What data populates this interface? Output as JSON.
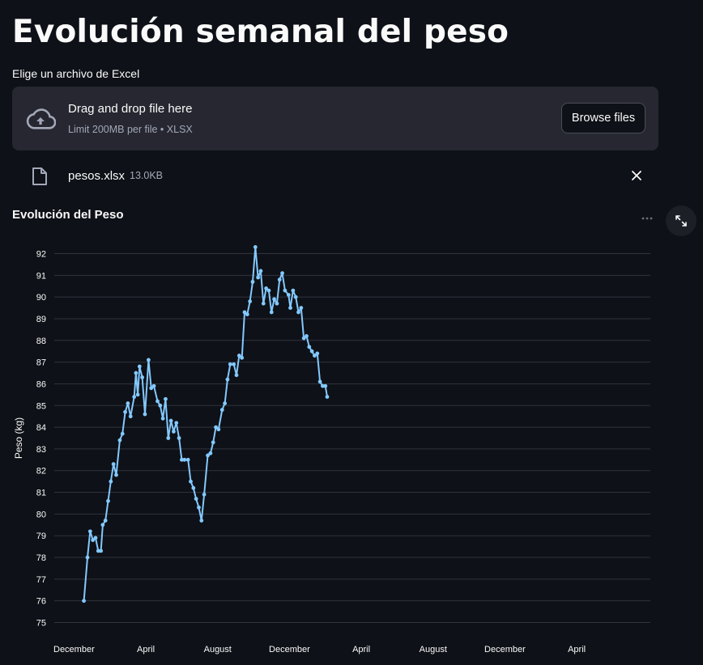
{
  "page": {
    "title": "Evolución semanal del peso"
  },
  "uploader": {
    "label": "Elige un archivo de Excel",
    "drop_text": "Drag and drop file here",
    "limit_text": "Limit 200MB per file • XLSX",
    "browse_label": "Browse files",
    "file_name": "pesos.xlsx",
    "file_size": "13.0KB"
  },
  "chart_section": {
    "title": "Evolución del Peso"
  },
  "colors": {
    "line": "#83c9ff",
    "background": "#0e1117",
    "grid": "#31333f"
  },
  "chart_data": {
    "type": "line",
    "title": "",
    "xlabel": "",
    "ylabel": "Peso (kg)",
    "ylim": [
      75,
      92
    ],
    "yticks": [
      75,
      76,
      77,
      78,
      79,
      80,
      81,
      82,
      83,
      84,
      85,
      86,
      87,
      88,
      89,
      90,
      91,
      92
    ],
    "xticks": [
      {
        "x": 0,
        "label": "December"
      },
      {
        "x": 4,
        "label": "April"
      },
      {
        "x": 8,
        "label": "August"
      },
      {
        "x": 12,
        "label": "December"
      },
      {
        "x": 16,
        "label": "April"
      },
      {
        "x": 20,
        "label": "August"
      },
      {
        "x": 24,
        "label": "December"
      },
      {
        "x": 28,
        "label": "April"
      }
    ],
    "xlim": [
      -1.1,
      32.1
    ],
    "grid": true,
    "series": [
      {
        "values": [
          [
            0.55,
            76.0
          ],
          [
            0.75,
            78.0
          ],
          [
            0.9,
            79.2
          ],
          [
            1.05,
            78.8
          ],
          [
            1.2,
            78.9
          ],
          [
            1.35,
            78.3
          ],
          [
            1.5,
            78.3
          ],
          [
            1.6,
            79.5
          ],
          [
            1.75,
            79.7
          ],
          [
            1.9,
            80.6
          ],
          [
            2.05,
            81.5
          ],
          [
            2.2,
            82.3
          ],
          [
            2.35,
            81.8
          ],
          [
            2.55,
            83.4
          ],
          [
            2.7,
            83.7
          ],
          [
            2.85,
            84.7
          ],
          [
            3.0,
            85.1
          ],
          [
            3.15,
            84.5
          ],
          [
            3.35,
            85.4
          ],
          [
            3.45,
            86.5
          ],
          [
            3.55,
            85.5
          ],
          [
            3.65,
            86.8
          ],
          [
            3.8,
            86.3
          ],
          [
            3.95,
            84.6
          ],
          [
            4.15,
            87.1
          ],
          [
            4.3,
            85.8
          ],
          [
            4.45,
            85.9
          ],
          [
            4.65,
            85.2
          ],
          [
            4.8,
            85.0
          ],
          [
            4.95,
            84.4
          ],
          [
            5.1,
            85.3
          ],
          [
            5.25,
            83.5
          ],
          [
            5.4,
            84.3
          ],
          [
            5.55,
            83.8
          ],
          [
            5.7,
            84.2
          ],
          [
            5.85,
            83.5
          ],
          [
            6.0,
            82.5
          ],
          [
            6.15,
            82.5
          ],
          [
            6.35,
            82.5
          ],
          [
            6.5,
            81.5
          ],
          [
            6.65,
            81.2
          ],
          [
            6.8,
            80.7
          ],
          [
            6.95,
            80.3
          ],
          [
            7.1,
            79.7
          ],
          [
            7.25,
            80.9
          ],
          [
            7.45,
            82.7
          ],
          [
            7.6,
            82.8
          ],
          [
            7.75,
            83.3
          ],
          [
            7.9,
            84.0
          ],
          [
            8.05,
            83.9
          ],
          [
            8.25,
            84.8
          ],
          [
            8.4,
            85.1
          ],
          [
            8.55,
            86.2
          ],
          [
            8.7,
            86.9
          ],
          [
            8.9,
            86.9
          ],
          [
            9.05,
            86.4
          ],
          [
            9.2,
            87.3
          ],
          [
            9.35,
            87.2
          ],
          [
            9.5,
            89.3
          ],
          [
            9.65,
            89.2
          ],
          [
            9.8,
            89.8
          ],
          [
            9.95,
            90.7
          ],
          [
            10.1,
            92.3
          ],
          [
            10.25,
            90.9
          ],
          [
            10.4,
            91.2
          ],
          [
            10.55,
            89.7
          ],
          [
            10.7,
            90.4
          ],
          [
            10.85,
            90.3
          ],
          [
            11.0,
            89.3
          ],
          [
            11.15,
            89.9
          ],
          [
            11.3,
            89.7
          ],
          [
            11.45,
            90.8
          ],
          [
            11.6,
            91.1
          ],
          [
            11.75,
            90.3
          ],
          [
            11.95,
            90.1
          ],
          [
            12.05,
            89.5
          ],
          [
            12.2,
            90.3
          ],
          [
            12.35,
            90.0
          ],
          [
            12.5,
            89.3
          ],
          [
            12.65,
            89.5
          ],
          [
            12.8,
            88.1
          ],
          [
            12.95,
            88.2
          ],
          [
            13.1,
            87.7
          ],
          [
            13.25,
            87.5
          ],
          [
            13.4,
            87.3
          ],
          [
            13.55,
            87.4
          ],
          [
            13.7,
            86.1
          ],
          [
            13.85,
            85.9
          ],
          [
            14.0,
            85.9
          ],
          [
            14.1,
            85.4
          ]
        ]
      }
    ]
  }
}
